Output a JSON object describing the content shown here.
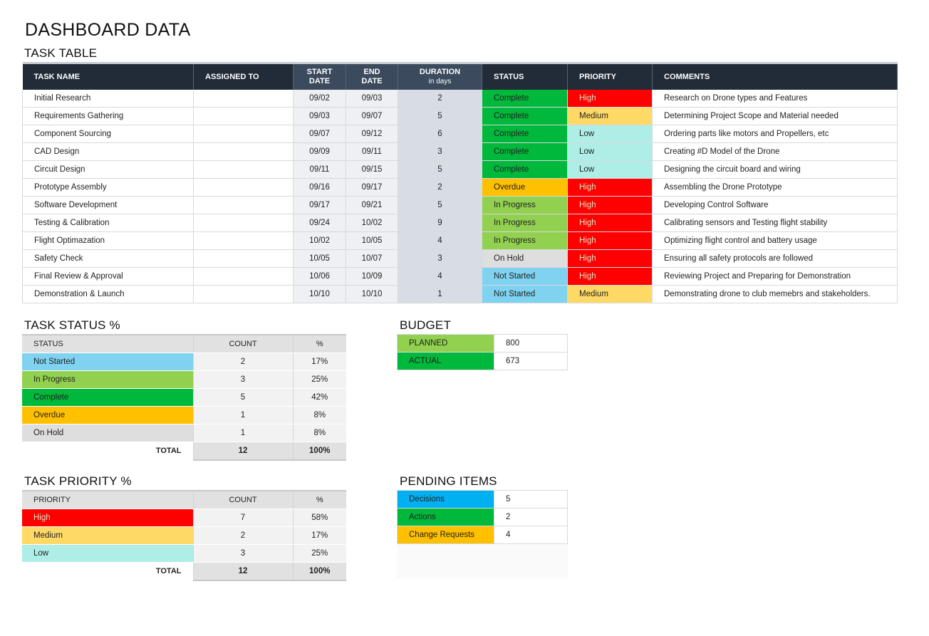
{
  "title": "DASHBOARD DATA",
  "task_table": {
    "section_title": "TASK TABLE",
    "headers": {
      "task_name": "TASK NAME",
      "assigned_to": "ASSIGNED TO",
      "start_date": "START DATE",
      "end_date": "END DATE",
      "duration": "DURATION",
      "duration_sub": "in days",
      "status": "STATUS",
      "priority": "PRIORITY",
      "comments": "COMMENTS"
    },
    "rows": [
      {
        "task": "Initial Research",
        "assigned": "",
        "start": "09/02",
        "end": "09/03",
        "duration": "2",
        "status": "Complete",
        "priority": "High",
        "comments": "Research on Drone types and Features"
      },
      {
        "task": "Requirements Gathering",
        "assigned": "",
        "start": "09/03",
        "end": "09/07",
        "duration": "5",
        "status": "Complete",
        "priority": "Medium",
        "comments": "Determining Project Scope and Material needed"
      },
      {
        "task": "Component Sourcing",
        "assigned": "",
        "start": "09/07",
        "end": "09/12",
        "duration": "6",
        "status": "Complete",
        "priority": "Low",
        "comments": "Ordering parts like motors and Propellers, etc"
      },
      {
        "task": "CAD Design",
        "assigned": "",
        "start": "09/09",
        "end": "09/11",
        "duration": "3",
        "status": "Complete",
        "priority": "Low",
        "comments": "Creating #D Model of the Drone"
      },
      {
        "task": "Circuit Design",
        "assigned": "",
        "start": "09/11",
        "end": "09/15",
        "duration": "5",
        "status": "Complete",
        "priority": "Low",
        "comments": "Designing the circuit board and wiring"
      },
      {
        "task": "Prototype Assembly",
        "assigned": "",
        "start": "09/16",
        "end": "09/17",
        "duration": "2",
        "status": "Overdue",
        "priority": "High",
        "comments": "Assembling the Drone Prototype"
      },
      {
        "task": "Software Development",
        "assigned": "",
        "start": "09/17",
        "end": "09/21",
        "duration": "5",
        "status": "In Progress",
        "priority": "High",
        "comments": "Developing Control Software"
      },
      {
        "task": "Testing & Calibration",
        "assigned": "",
        "start": "09/24",
        "end": "10/02",
        "duration": "9",
        "status": "In Progress",
        "priority": "High",
        "comments": "Calibrating sensors and Testing flight stability"
      },
      {
        "task": "Flight Optimazation",
        "assigned": "",
        "start": "10/02",
        "end": "10/05",
        "duration": "4",
        "status": "In Progress",
        "priority": "High",
        "comments": "Optimizing flight control and battery usage"
      },
      {
        "task": "Safety Check",
        "assigned": "",
        "start": "10/05",
        "end": "10/07",
        "duration": "3",
        "status": "On Hold",
        "priority": "High",
        "comments": "Ensuring all safety protocols are followed"
      },
      {
        "task": "Final Review & Approval",
        "assigned": "",
        "start": "10/06",
        "end": "10/09",
        "duration": "4",
        "status": "Not Started",
        "priority": "High",
        "comments": "Reviewing Project and Preparing for Demonstration"
      },
      {
        "task": "Demonstration & Launch",
        "assigned": "",
        "start": "10/10",
        "end": "10/10",
        "duration": "1",
        "status": "Not Started",
        "priority": "Medium",
        "comments": "Demonstrating drone to club memebrs and stakeholders."
      }
    ]
  },
  "status_summary": {
    "section_title": "TASK STATUS %",
    "headers": {
      "label": "STATUS",
      "count": "COUNT",
      "pct": "%"
    },
    "rows": [
      {
        "label": "Not Started",
        "count": "2",
        "pct": "17%"
      },
      {
        "label": "In Progress",
        "count": "3",
        "pct": "25%"
      },
      {
        "label": "Complete",
        "count": "5",
        "pct": "42%"
      },
      {
        "label": "Overdue",
        "count": "1",
        "pct": "8%"
      },
      {
        "label": "On Hold",
        "count": "1",
        "pct": "8%"
      }
    ],
    "total": {
      "label": "TOTAL",
      "count": "12",
      "pct": "100%"
    }
  },
  "priority_summary": {
    "section_title": "TASK PRIORITY %",
    "headers": {
      "label": "PRIORITY",
      "count": "COUNT",
      "pct": "%"
    },
    "rows": [
      {
        "label": "High",
        "count": "7",
        "pct": "58%"
      },
      {
        "label": "Medium",
        "count": "2",
        "pct": "17%"
      },
      {
        "label": "Low",
        "count": "3",
        "pct": "25%"
      }
    ],
    "total": {
      "label": "TOTAL",
      "count": "12",
      "pct": "100%"
    }
  },
  "budget": {
    "section_title": "BUDGET",
    "planned_label": "PLANNED",
    "planned_value": "800",
    "actual_label": "ACTUAL",
    "actual_value": "673"
  },
  "pending": {
    "section_title": "PENDING ITEMS",
    "decisions_label": "Decisions",
    "decisions_value": "5",
    "actions_label": "Actions",
    "actions_value": "2",
    "change_label": "Change Requests",
    "change_value": "4"
  },
  "colors": {
    "header_dark": "#222b38",
    "complete": "#00b83b",
    "in_progress": "#92d050",
    "overdue": "#ffc000",
    "on_hold": "#dedede",
    "not_started": "#7fd3f0",
    "high": "#ff0000",
    "medium": "#ffd966",
    "low": "#aeeee6"
  }
}
